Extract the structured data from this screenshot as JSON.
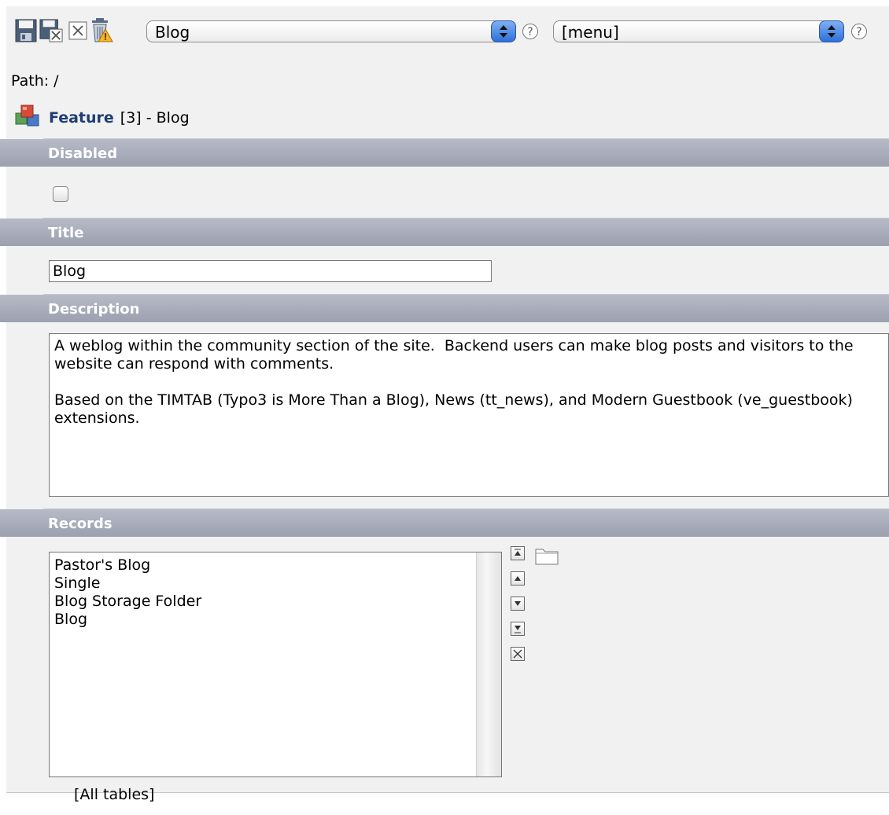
{
  "toolbar": {
    "buttons": [
      {
        "name": "save-icon",
        "label": "Save"
      },
      {
        "name": "save-and-close-icon",
        "label": "Save and close"
      },
      {
        "name": "close-icon",
        "label": "Close"
      },
      {
        "name": "delete-icon",
        "label": "Delete"
      }
    ],
    "record_select_value": "Blog",
    "menu_select_value": "[menu]"
  },
  "path": {
    "label": "Path: /"
  },
  "record": {
    "table_name": "Feature",
    "rest": "[3] - Blog"
  },
  "sections": {
    "disabled": {
      "label": "Disabled",
      "checked": false
    },
    "title": {
      "label": "Title",
      "value": "Blog"
    },
    "description": {
      "label": "Description",
      "value": "A weblog within the community section of the site.  Backend users can make blog posts and visitors to the website can respond with comments.\n\nBased on the TIMTAB (Typo3 is More Than a Blog), News (tt_news), and Modern Guestbook (ve_guestbook) extensions."
    },
    "records": {
      "label": "Records",
      "items": [
        "Pastor's Blog",
        "Single",
        "Blog Storage Folder",
        "Blog"
      ],
      "footer": "[All tables]"
    }
  },
  "colors": {
    "section_header_top": "#b7bac6",
    "section_header_bottom": "#9ca0af",
    "page_bg": "#f1f1f1",
    "title_link": "#1e3d74",
    "select_arrow": "#2d6fd8"
  }
}
